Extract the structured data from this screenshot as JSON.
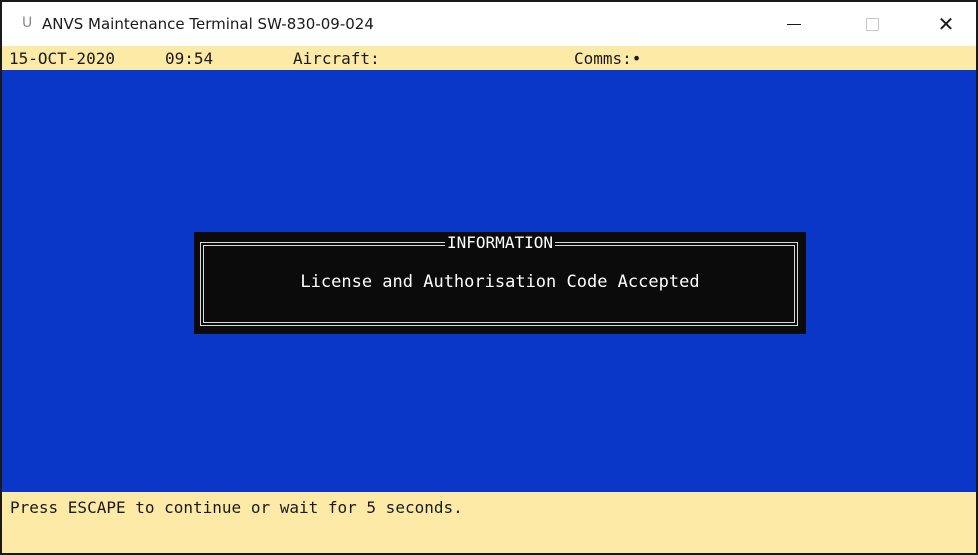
{
  "window": {
    "icon": "U",
    "title": "ANVS Maintenance Terminal SW-830-09-024",
    "close_glyph": "✕"
  },
  "status": {
    "date": "15-OCT-2020",
    "time": "09:54",
    "aircraft_label": "Aircraft:",
    "comms_label": "Comms:•"
  },
  "dialog": {
    "title": "INFORMATION",
    "message": "License and Authorisation Code Accepted"
  },
  "footer": {
    "message": "Press ESCAPE to continue or wait for 5 seconds."
  },
  "colors": {
    "screen_bg": "#0a37c8",
    "status_bg": "#fdeaa6",
    "dialog_bg": "#0b0b0b",
    "dialog_text": "#ffffff"
  },
  "icons": {
    "app": "app-icon",
    "minimize": "minimize-icon",
    "maximize": "maximize-icon",
    "close": "close-icon"
  }
}
